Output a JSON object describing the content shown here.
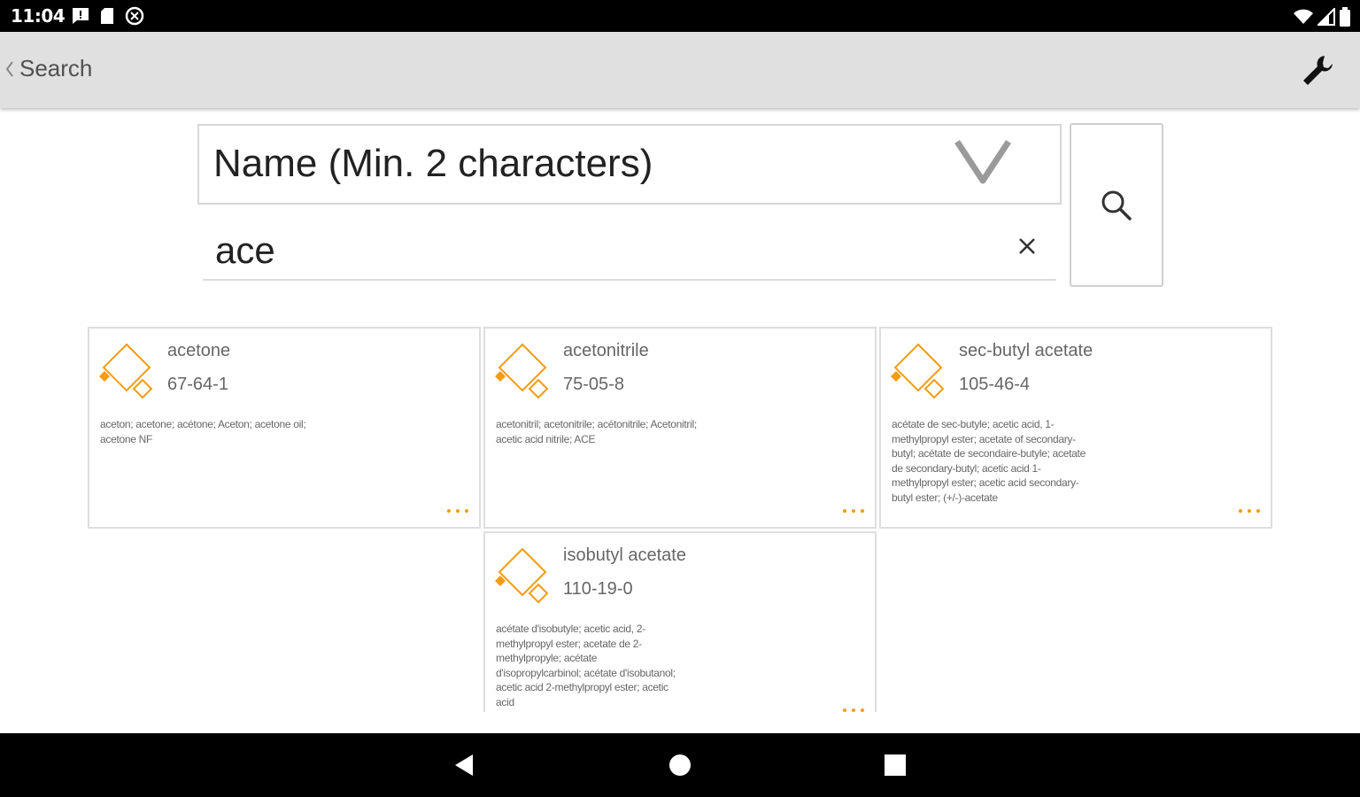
{
  "status_bar": {
    "time": "11:04",
    "left_icons": [
      "message-icon",
      "sd-card-icon",
      "data-saver-icon"
    ],
    "right_icons": [
      "wifi-icon",
      "signal-icon",
      "battery-icon"
    ]
  },
  "app_bar": {
    "back_icon": "chevron-left-icon",
    "title": "Search",
    "settings_icon": "wrench-icon"
  },
  "search": {
    "type_selected": "Name (Min. 2 characters)",
    "query": "ace",
    "clear_icon": "close-icon",
    "button_icon": "search-icon"
  },
  "accent_color": "#f39c12",
  "results": [
    {
      "name": "acetone",
      "cas": "67-64-1",
      "synonyms": "aceton; acetone; acétone; Aceton; acetone oil; acetone NF"
    },
    {
      "name": "acetonitrile",
      "cas": "75-05-8",
      "synonyms": "acetonitril; acetonitrile; acétonitrile; Acetonitril; acetic acid nitrile; ACE"
    },
    {
      "name": "sec-butyl acetate",
      "cas": "105-46-4",
      "synonyms": "acétate de sec-butyle; acetic acid, 1-methylpropyl ester; acetate of secondary-butyl; acétate de secondaire-butyle; acetate de secondary-butyl; acetic acid 1-methylpropyl ester; acetic acid secondary-butyl ester; (+/-)-acetate"
    },
    {
      "name": "isobutyl acetate",
      "cas": "110-19-0",
      "synonyms": "acétate d'isobutyle; acetic acid, 2-methylpropyl ester; acetate de 2-methylpropyle; acétate d'isopropylcarbinol; acétate d'isobutanol; acetic acid 2-methylpropyl ester; acetic acid"
    }
  ],
  "nav_bar": {
    "back": "back-triangle-icon",
    "home": "home-circle-icon",
    "recents": "recents-square-icon"
  }
}
